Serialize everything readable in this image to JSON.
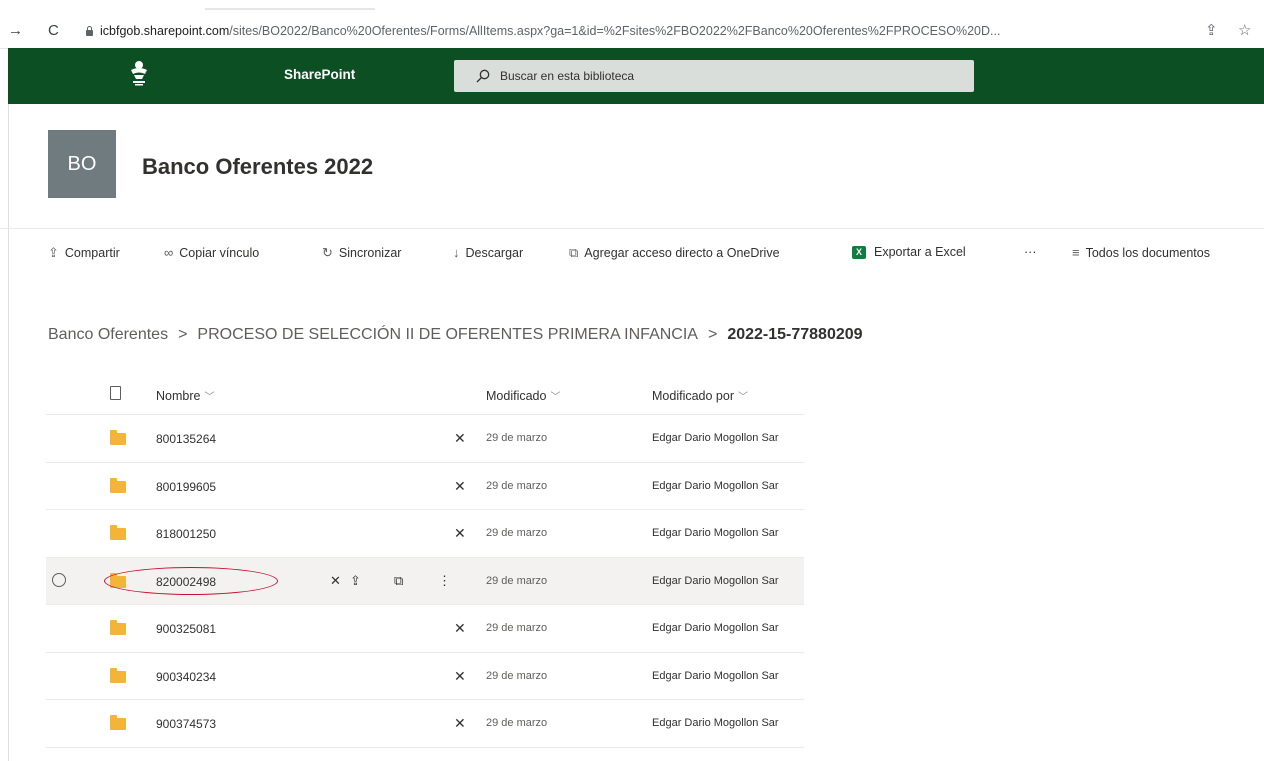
{
  "browser": {
    "url_host": "icbfgob.sharepoint.com",
    "url_path": "/sites/BO2022/Banco%20Oferentes/Forms/AllItems.aspx?ga=1&id=%2Fsites%2FBO2022%2FBanco%20Oferentes%2FPROCESO%20D...",
    "forward_icon": "→",
    "reload_icon": "C",
    "share_icon": "⇪",
    "star_icon": "☆"
  },
  "suitebar": {
    "app_name": "SharePoint",
    "search_placeholder": "Buscar en esta biblioteca",
    "bg_color": "#0b4f23"
  },
  "site": {
    "logo_initials": "BO",
    "title": "Banco Oferentes 2022"
  },
  "commands": {
    "share": "Compartir",
    "copy_link": "Copiar vínculo",
    "sync": "Sincronizar",
    "download": "Descargar",
    "add_shortcut": "Agregar acceso directo a OneDrive",
    "export_excel": "Exportar a Excel",
    "more": "···",
    "view": "Todos los documentos"
  },
  "breadcrumb": {
    "root": "Banco Oferentes",
    "folder": "PROCESO DE SELECCIÓN II DE OFERENTES PRIMERA INFANCIA",
    "current": "2022-15-77880209",
    "separator": ">"
  },
  "list": {
    "columns": {
      "name": "Nombre",
      "modified": "Modificado",
      "modified_by": "Modificado por"
    },
    "rows": [
      {
        "name": "800135264",
        "modified": "29 de marzo",
        "modified_by": "Edgar Dario Mogollon Sar"
      },
      {
        "name": "800199605",
        "modified": "29 de marzo",
        "modified_by": "Edgar Dario Mogollon Sar"
      },
      {
        "name": "818001250",
        "modified": "29 de marzo",
        "modified_by": "Edgar Dario Mogollon Sar"
      },
      {
        "name": "820002498",
        "modified": "29 de marzo",
        "modified_by": "Edgar Dario Mogollon Sar",
        "selected": true
      },
      {
        "name": "900325081",
        "modified": "29 de marzo",
        "modified_by": "Edgar Dario Mogollon Sar"
      },
      {
        "name": "900340234",
        "modified": "29 de marzo",
        "modified_by": "Edgar Dario Mogollon Sar"
      },
      {
        "name": "900374573",
        "modified": "29 de marzo",
        "modified_by": "Edgar Dario Mogollon Sar"
      }
    ]
  }
}
